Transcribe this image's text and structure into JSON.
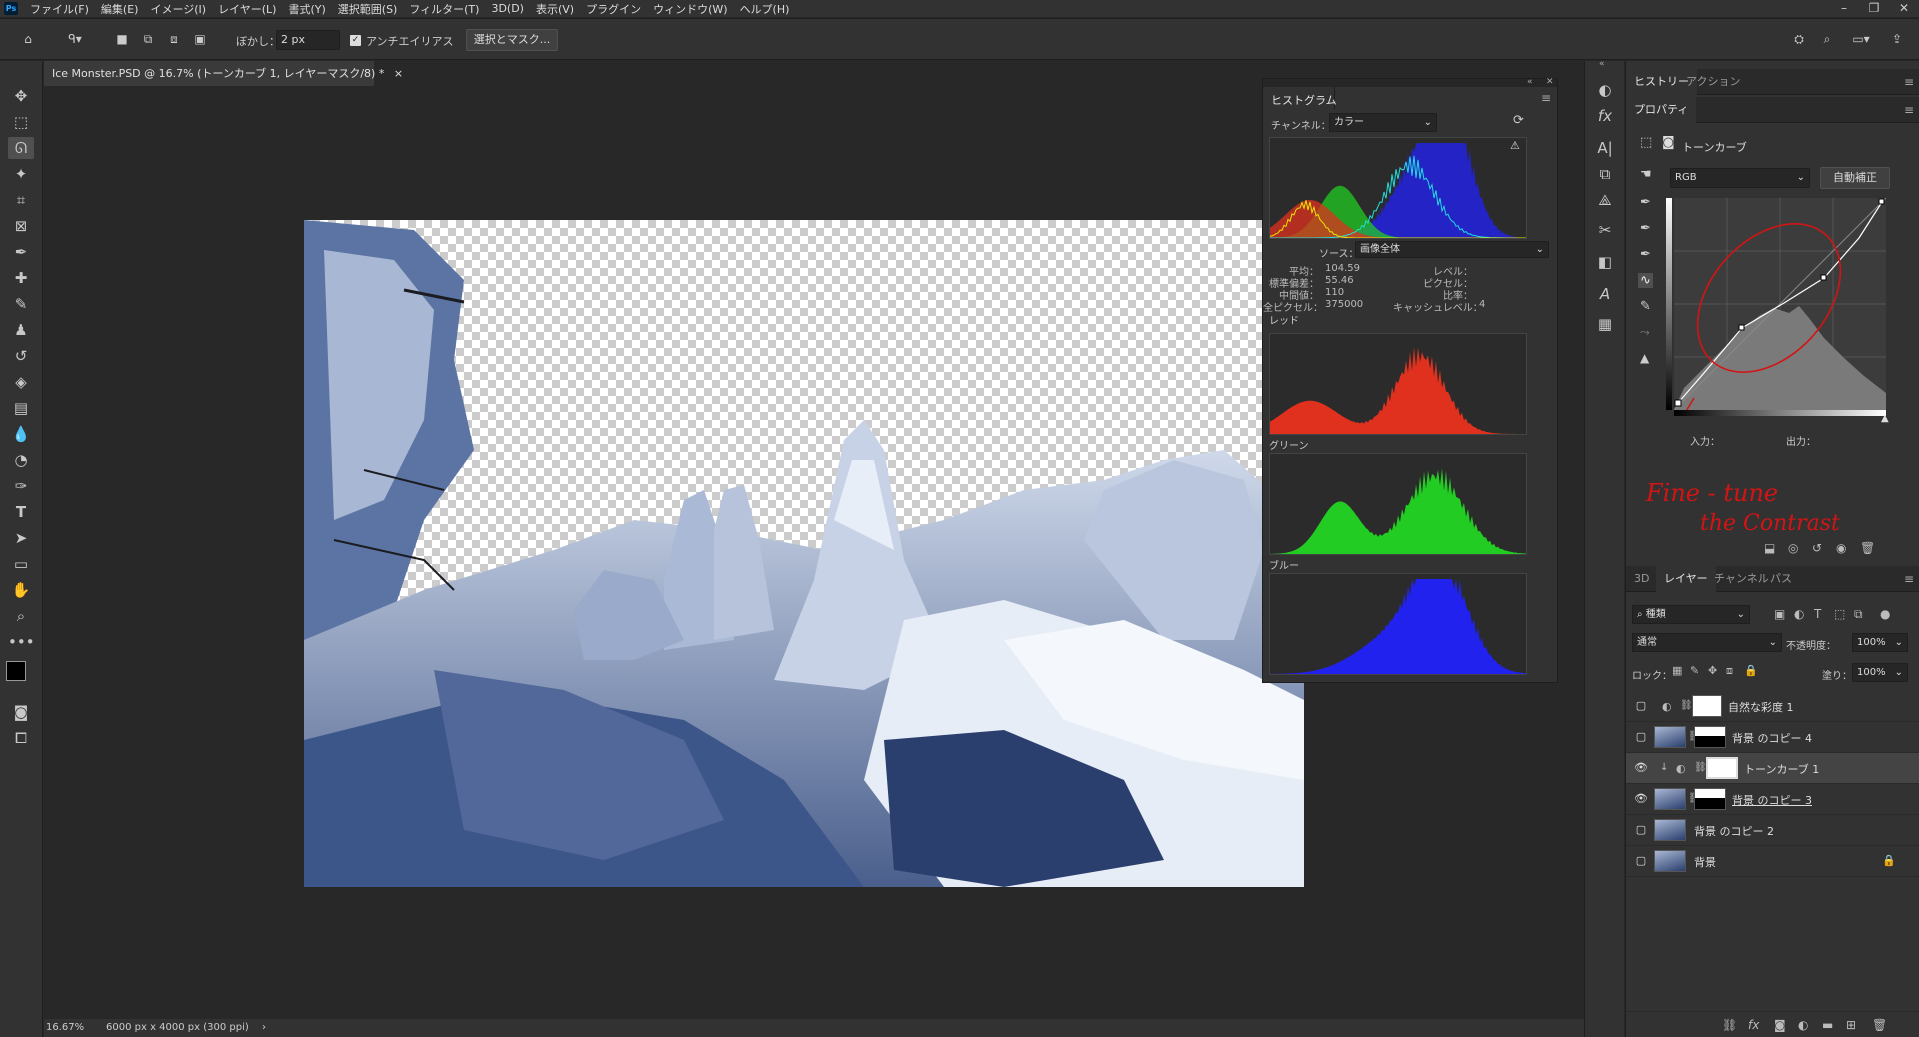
{
  "menubar": {
    "logo": "Ps",
    "items": [
      "ファイル(F)",
      "編集(E)",
      "イメージ(I)",
      "レイヤー(L)",
      "書式(Y)",
      "選択範囲(S)",
      "フィルター(T)",
      "3D(D)",
      "表示(V)",
      "プラグイン",
      "ウィンドウ(W)",
      "ヘルプ(H)"
    ]
  },
  "options": {
    "feather_label": "ぼかし：",
    "feather_value": "2 px",
    "antialias_label": "アンチエイリアス",
    "select_mask": "選択とマスク..."
  },
  "document": {
    "tab_title": "Ice Monster.PSD @ 16.7% (トーンカーブ 1, レイヤーマスク/8) *",
    "close": "×"
  },
  "status": {
    "zoom": "16.67%",
    "size": "6000 px x 4000 px (300 ppi)",
    "arrow": "›"
  },
  "histogram": {
    "title": "ヒストグラム",
    "channel_label": "チャンネル：",
    "channel_value": "カラー",
    "source_label": "ソース：",
    "source_value": "画像全体",
    "stats_left": [
      {
        "k": "平均：",
        "v": "104.59"
      },
      {
        "k": "標準偏差：",
        "v": "55.46"
      },
      {
        "k": "中間値：",
        "v": "110"
      },
      {
        "k": "全ピクセル：",
        "v": "375000"
      }
    ],
    "stats_right": [
      {
        "k": "レベル：",
        "v": ""
      },
      {
        "k": "ピクセル：",
        "v": ""
      },
      {
        "k": "比率：",
        "v": ""
      },
      {
        "k": "キャッシュレベル：",
        "v": "4"
      }
    ],
    "red_label": "レッド",
    "green_label": "グリーン",
    "blue_label": "ブルー",
    "colors": {
      "red": "#e0301e",
      "green": "#22cc22",
      "blue": "#2222ee",
      "yellow": "#e6e600",
      "cyan": "#22dddd"
    }
  },
  "history_tabs": {
    "history": "ヒストリー",
    "actions": "アクション"
  },
  "properties": {
    "title": "プロパティ",
    "type": "トーンカーブ",
    "preset": "RGB",
    "auto_label": "自動補正",
    "input_label": "入力：",
    "output_label": "出力："
  },
  "annotation": {
    "line1": "Fine - tune",
    "line2": "the Contrast"
  },
  "layer_tabs": {
    "t3d": "3D",
    "layers": "レイヤー",
    "channels": "チャンネル",
    "paths": "パス"
  },
  "layers_panel": {
    "filter_kind": "種類",
    "blend_mode": "通常",
    "opacity_label": "不透明度：",
    "opacity_value": "100%",
    "lock_label": "ロック：",
    "fill_label": "塗り：",
    "fill_value": "100%"
  },
  "layers": [
    {
      "name": "自然な彩度 1",
      "visible": false,
      "kind": "adjustment"
    },
    {
      "name": "背景 のコピー 4",
      "visible": false,
      "kind": "masked"
    },
    {
      "name": "トーンカーブ 1",
      "visible": true,
      "kind": "curves",
      "selected": true
    },
    {
      "name": "背景 のコピー 3",
      "visible": true,
      "kind": "masked"
    },
    {
      "name": "背景 のコピー 2",
      "visible": false,
      "kind": "image"
    },
    {
      "name": "背景",
      "visible": false,
      "kind": "image",
      "locked": true
    }
  ]
}
